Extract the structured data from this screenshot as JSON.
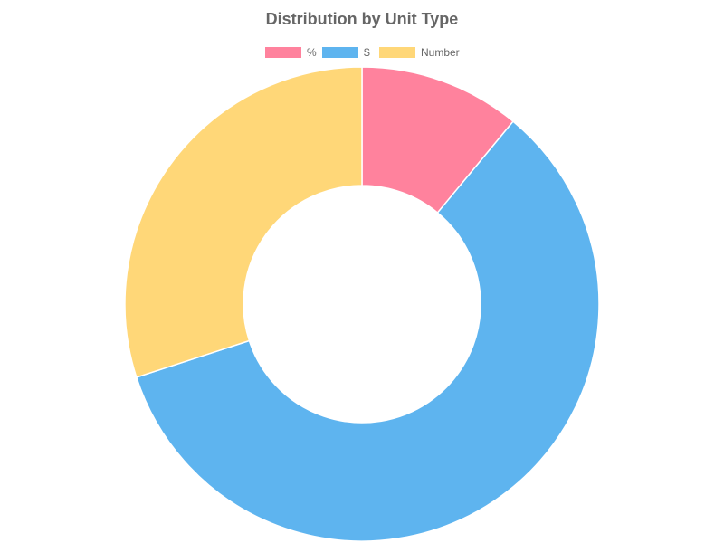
{
  "chart_data": {
    "type": "pie",
    "variant": "doughnut",
    "title": "Distribution by Unit Type",
    "legend_position": "top",
    "categories": [
      "%",
      "$",
      "Number"
    ],
    "values": [
      11,
      59,
      30
    ],
    "colors": [
      "#ff829d",
      "#5eb4ef",
      "#ffd778"
    ],
    "border_color": "#ffffff"
  }
}
